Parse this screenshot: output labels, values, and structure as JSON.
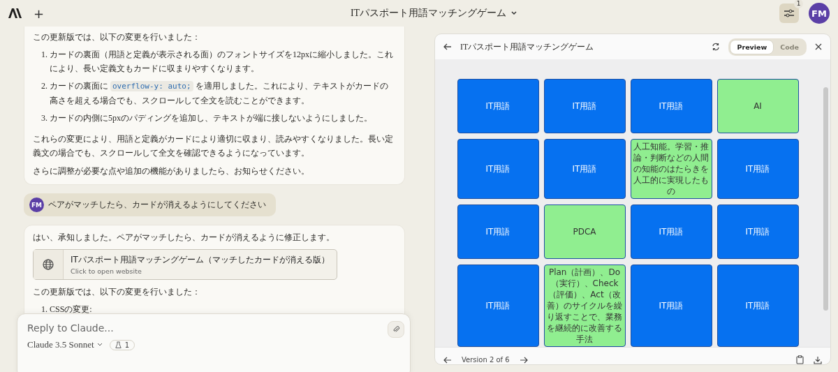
{
  "top_bar": {
    "new_chat": "+",
    "title": "ITパスポート用語マッチングゲーム",
    "avatar": "FM",
    "badge": "1"
  },
  "messages": [
    {
      "kind": "assistant",
      "blocks": [
        {
          "kind": "para",
          "text": "この更新版では、以下の変更を行いました："
        },
        {
          "kind": "list",
          "items": [
            {
              "num": "1.",
              "text": "カードの裏面（用語と定義が表示される面）のフォントサイズを12pxに縮小しました。これにより、長い定義文もカードに収まりやすくなります。"
            },
            {
              "num": "2.",
              "before": "カードの裏面に",
              "code": "overflow-y: auto;",
              "after": "を適用しました。これにより、テキストがカードの高さを超える場合でも、スクロールして全文を読むことができます。"
            },
            {
              "num": "3.",
              "text": "カードの内側に5pxのパディングを追加し、テキストが端に接しないようにしました。"
            }
          ]
        },
        {
          "kind": "para",
          "text": "これらの変更により、用語と定義がカードにより適切に収まり、読みやすくなりました。長い定義文の場合でも、スクロールして全文を確認できるようになっています。"
        },
        {
          "kind": "para",
          "text": "さらに調整が必要な点や追加の機能がありましたら、お知らせください。"
        }
      ]
    },
    {
      "kind": "user",
      "avatar": "FM",
      "text": "ペアがマッチしたら、カードが消えるようにしてください"
    },
    {
      "kind": "assistant",
      "blocks": [
        {
          "kind": "para",
          "text": "はい、承知しました。ペアがマッチしたら、カードが消えるように修正します。"
        },
        {
          "kind": "artifact",
          "title": "ITパスポート用語マッチングゲーム（マッチしたカードが消える版）",
          "subtitle": "Click to open website"
        },
        {
          "kind": "para",
          "text": "この更新版では、以下の変更を行いました："
        },
        {
          "kind": "list",
          "items": [
            {
              "num": "1.",
              "text": "CSSの変更:"
            }
          ]
        }
      ]
    }
  ],
  "composer": {
    "placeholder": "Reply to Claude...",
    "model": "Claude 3.5 Sonnet",
    "count": "1"
  },
  "panel": {
    "title": "ITパスポート用語マッチングゲーム",
    "tabs": [
      {
        "label": "Preview",
        "selected": true
      },
      {
        "label": "Code",
        "selected": false
      }
    ],
    "cards": [
      {
        "revealed": false,
        "text": "IT用語"
      },
      {
        "revealed": false,
        "text": "IT用語"
      },
      {
        "revealed": false,
        "text": "IT用語"
      },
      {
        "revealed": true,
        "text": "AI"
      },
      {
        "revealed": false,
        "text": "IT用語"
      },
      {
        "revealed": false,
        "text": "IT用語"
      },
      {
        "revealed": true,
        "text": "人工知能。学習・推論・判断などの人間の知能のはたらきを人工的に実現したもの"
      },
      {
        "revealed": false,
        "text": "IT用語"
      },
      {
        "revealed": false,
        "text": "IT用語"
      },
      {
        "revealed": true,
        "text": "PDCA"
      },
      {
        "revealed": false,
        "text": "IT用語"
      },
      {
        "revealed": false,
        "text": "IT用語"
      },
      {
        "revealed": false,
        "text": "IT用語"
      },
      {
        "revealed": true,
        "text": "Plan（計画）、Do（実行）、Check（評価）、Act（改善）のサイクルを繰り返すことで、業務を継続的に改善する手法"
      },
      {
        "revealed": false,
        "text": "IT用語"
      },
      {
        "revealed": false,
        "text": "IT用語"
      }
    ],
    "version": "Version 2 of 6"
  }
}
